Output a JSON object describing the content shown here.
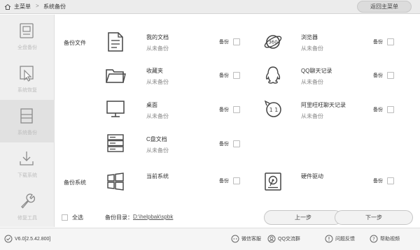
{
  "breadcrumb": {
    "home": "主菜单",
    "separator": ">",
    "current": "系统备份"
  },
  "header": {
    "return_button": "返回主菜单"
  },
  "sidebar": {
    "items": [
      {
        "label": "全盘备份",
        "icon": "computer-icon",
        "active": false
      },
      {
        "label": "系统恢复",
        "icon": "cursor-icon",
        "active": false
      },
      {
        "label": "系统备份",
        "icon": "document-icon",
        "active": true
      },
      {
        "label": "下载系统",
        "icon": "download-icon",
        "active": false
      },
      {
        "label": "修复工具",
        "icon": "wrench-icon",
        "active": false
      }
    ]
  },
  "main": {
    "section_files": "备份文件",
    "section_system": "备份系统",
    "backup_label": "备份",
    "items": [
      {
        "title": "我的文档",
        "subtitle": "从未备份",
        "icon": "document-icon"
      },
      {
        "title": "浏览器",
        "subtitle": "从未备份",
        "icon": "browser-icon"
      },
      {
        "title": "收藏夹",
        "subtitle": "从未备份",
        "icon": "folder-icon"
      },
      {
        "title": "QQ聊天记录",
        "subtitle": "从未备份",
        "icon": "qq-icon"
      },
      {
        "title": "桌面",
        "subtitle": "从未备份",
        "icon": "monitor-icon"
      },
      {
        "title": "阿里旺旺聊天记录",
        "subtitle": "从未备份",
        "icon": "wangwang-icon"
      },
      {
        "title": "C盘文档",
        "subtitle": "从未备份",
        "icon": "drive-icon"
      },
      {
        "title": "当前系统",
        "subtitle": "",
        "icon": "windows-icon"
      },
      {
        "title": "硬件驱动",
        "subtitle": "",
        "icon": "hardware-icon"
      }
    ]
  },
  "footer_controls": {
    "select_all": "全选",
    "backup_dir_label": "备份目录：",
    "backup_dir_path": "D:\\helpbak\\spbk",
    "prev_button": "上一步",
    "next_button": "下一步"
  },
  "status": {
    "version": "V6.0[2.5.42.800]",
    "items": [
      {
        "label": "微信客服",
        "icon": "wechat-icon"
      },
      {
        "label": "QQ交流群",
        "icon": "qq-group-icon"
      },
      {
        "label": "问题反馈",
        "icon": "feedback-icon"
      },
      {
        "label": "帮助视频",
        "icon": "help-video-icon"
      }
    ]
  }
}
